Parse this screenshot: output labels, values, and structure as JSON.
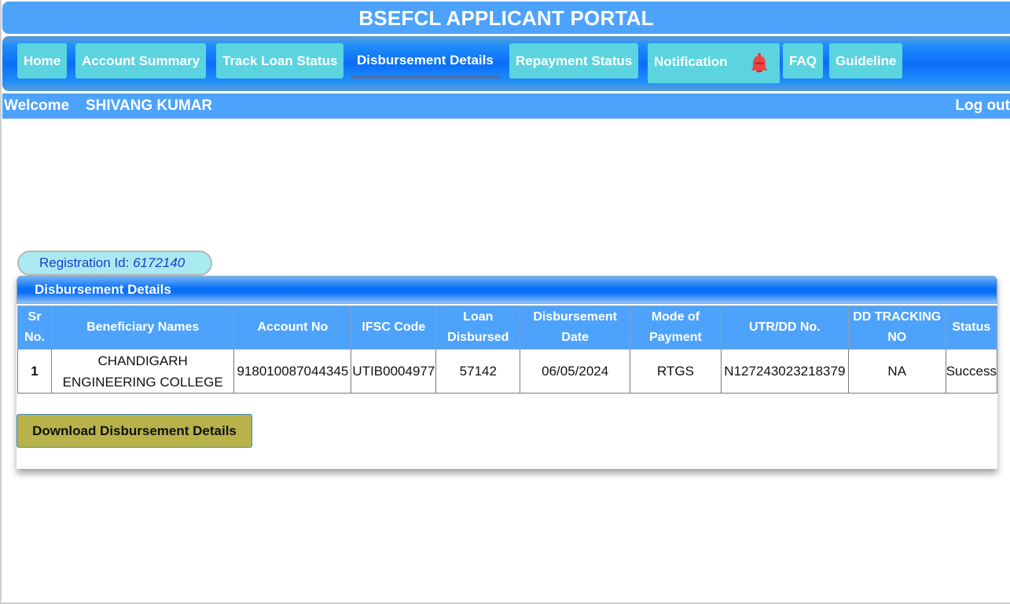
{
  "portal": {
    "title": "BSEFCL APPLICANT PORTAL"
  },
  "nav": {
    "home": "Home",
    "account_summary": "Account Summary",
    "track_loan_status": "Track Loan Status",
    "disbursement_details": "Disbursement Details",
    "repayment_status": "Repayment Status",
    "notification": "Notification",
    "faq": "FAQ",
    "guideline": "Guideline",
    "active": "disbursement_details"
  },
  "welcome": {
    "label": "Welcome",
    "user_name": "SHIVANG KUMAR",
    "logout": "Log out"
  },
  "registration": {
    "label": "Registration Id:",
    "value": "6172140"
  },
  "disbursement": {
    "heading": "Disbursement Details",
    "columns": [
      "Sr No.",
      "Beneficiary Names",
      "Account No",
      "IFSC Code",
      "Loan Disbursed",
      "Disbursement Date",
      "Mode of Payment",
      "UTR/DD No.",
      "DD TRACKING NO",
      "Status"
    ],
    "rows": [
      {
        "sr_no": "1",
        "beneficiary": "CHANDIGARH ENGINEERING COLLEGE",
        "account_no": "918010087044345",
        "ifsc": "UTIB0004977",
        "loan_disbursed": "57142",
        "date": "06/05/2024",
        "mode": "RTGS",
        "utr": "N127243023218379",
        "dd_tracking": "NA",
        "status": "Success"
      }
    ],
    "download_button": "Download Disbursement Details"
  },
  "colors": {
    "title_bar": "#4da3fb",
    "nav_tab": "#5bd4e0",
    "nav_gradient": "#0a6ef7",
    "registration_pill": "#a9eaf1",
    "download_button": "#b8b24a",
    "bell": "#e23a3a"
  },
  "icons": {
    "notification": "bell-icon"
  }
}
